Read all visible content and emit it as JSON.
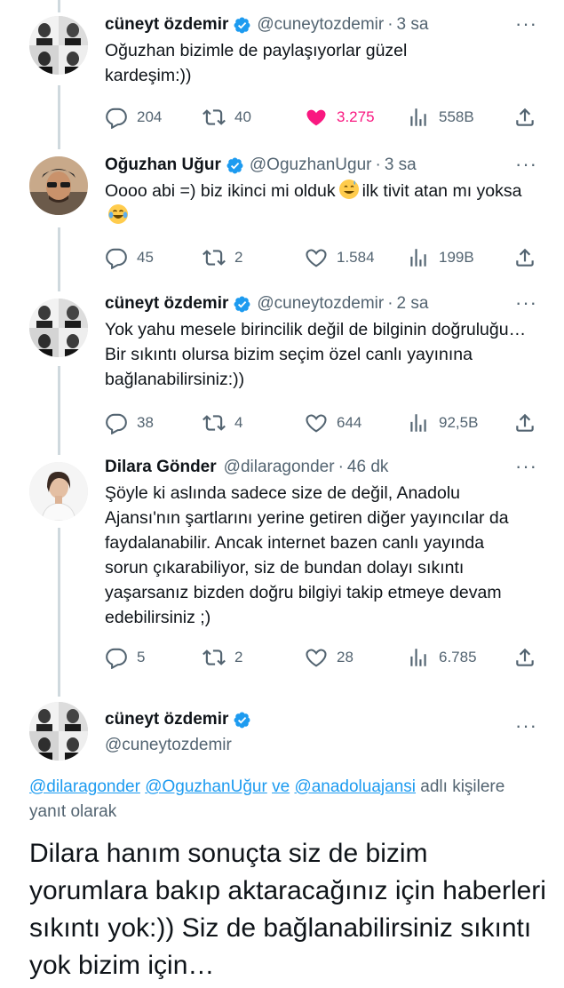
{
  "tweets": [
    {
      "name": "cüneyt özdemir",
      "handle": "@cuneytozdemir",
      "time": "3 sa",
      "text": "Oğuzhan bizimle de paylaşıyorlar güzel kardeşim:))",
      "replies": "204",
      "retweets": "40",
      "likes": "3.275",
      "views": "558B",
      "liked": true
    },
    {
      "name": "Oğuzhan Uğur",
      "handle": "@OguzhanUgur",
      "time": "3 sa",
      "text_parts": [
        "Oooo abi =) biz ikinci mi olduk",
        "ilk tivit atan mı yoksa"
      ],
      "replies": "45",
      "retweets": "2",
      "likes": "1.584",
      "views": "199B"
    },
    {
      "name": "cüneyt özdemir",
      "handle": "@cuneytozdemir",
      "time": "2 sa",
      "text": "Yok yahu mesele birincilik değil de bilginin doğruluğu… Bir sıkıntı olursa bizim seçim özel canlı yayınına bağlanabilirsiniz:))",
      "replies": "38",
      "retweets": "4",
      "likes": "644",
      "views": "92,5B"
    },
    {
      "name": "Dilara Gönder",
      "handle": "@dilaragonder",
      "time": "46 dk",
      "text": "Şöyle ki aslında sadece size de değil, Anadolu Ajansı'nın şartlarını yerine getiren diğer yayıncılar da faydalanabilir. Ancak  internet bazen canlı yayında sorun çıkarabiliyor, siz de bundan dolayı sıkıntı yaşarsanız bizden doğru bilgiyi takip etmeye devam edebilirsiniz  ;)",
      "replies": "5",
      "retweets": "2",
      "likes": "28",
      "views": "6.785"
    }
  ],
  "main_tweet": {
    "name": "cüneyt özdemir",
    "handle": "@cuneytozdemir",
    "reply_mentions": [
      "@dilaragonder",
      "@OguzhanUğur",
      "@anadoluajansi"
    ],
    "reply_joiner": "ve",
    "reply_suffix": "adlı kişilere yanıt olarak",
    "text": "Dilara hanım sonuçta siz de bizim yorumlara bakıp aktaracağınız için haberleri sıkıntı yok:)) Siz de bağlanabilirsiniz sıkıntı yok bizim için…"
  },
  "colors": {
    "accent": "#1d9bf0",
    "like": "#f91880",
    "muted": "#536471",
    "thread_line": "#cfd9de"
  },
  "icons": [
    "verified-badge-icon",
    "reply-icon",
    "retweet-icon",
    "like-icon",
    "views-icon",
    "share-icon",
    "more-icon",
    "grinning-sweat-emoji",
    "joy-emoji"
  ]
}
